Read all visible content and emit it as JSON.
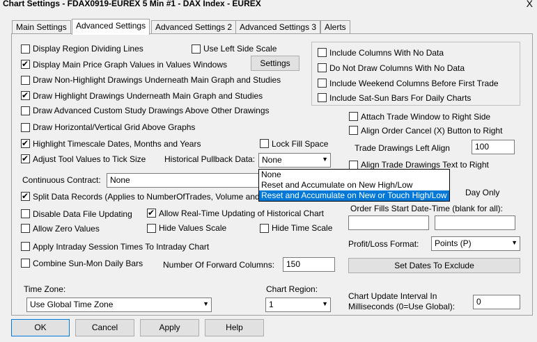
{
  "window": {
    "title": "Chart Settings - FDAX0919-EUREX  5 Min  #1 - DAX Index - EUREX",
    "close": "X"
  },
  "tabs": [
    "Main Settings",
    "Advanced Settings",
    "Advanced Settings 2",
    "Advanced Settings 3",
    "Alerts"
  ],
  "left": {
    "display_region_dividing_lines": "Display Region Dividing Lines",
    "use_left_side_scale": "Use Left Side Scale",
    "display_main_price_graph": "Display Main Price Graph Values in Values Windows",
    "settings_button": "Settings",
    "draw_non_highlight": "Draw Non-Highlight Drawings Underneath Main Graph and Studies",
    "draw_highlight": "Draw Highlight Drawings Underneath Main Graph and Studies",
    "draw_advanced_custom": "Draw Advanced Custom Study Drawings Above Other Drawings",
    "draw_grid_above": "Draw Horizontal/Vertical Grid Above Graphs",
    "highlight_timescale": "Highlight Timescale Dates, Months and Years",
    "lock_fill_space": "Lock Fill Space",
    "adjust_tool_values": "Adjust Tool Values to Tick Size",
    "historical_pullback_label": "Historical Pullback Data:",
    "historical_pullback_value": "None",
    "continuous_contract_label": "Continuous Contract:",
    "continuous_contract_value": "None",
    "split_data_records": "Split Data Records (Applies to NumberOfTrades, Volume and",
    "disable_data_file_updating": "Disable Data File Updating",
    "allow_realtime_updating": "Allow Real-Time Updating of Historical Chart",
    "allow_zero_values": "Allow Zero Values",
    "hide_values_scale": "Hide Values Scale",
    "hide_time_scale": "Hide Time Scale",
    "apply_intraday_session": "Apply Intraday Session Times To Intraday Chart",
    "combine_sun_mon": "Combine Sun-Mon Daily Bars",
    "forward_columns_label": "Number Of Forward Columns:",
    "forward_columns_value": "150",
    "time_zone_label": "Time Zone:",
    "time_zone_value": "Use Global Time Zone",
    "chart_region_label": "Chart Region:",
    "chart_region_value": "1"
  },
  "dropdown_options": [
    "None",
    "Reset and Accumulate on New High/Low",
    "Reset and Accumulate on New or Touch High/Low"
  ],
  "right": {
    "include_columns_no_data": "Include Columns With No Data",
    "do_not_draw_columns": "Do Not Draw Columns With No Data",
    "include_weekend_columns": "Include Weekend Columns Before First Trade",
    "include_sat_sun_bars": "Include Sat-Sun Bars For Daily Charts",
    "attach_trade_window": "Attach Trade Window to Right Side",
    "align_order_cancel": "Align Order Cancel (X) Button to Right",
    "trade_drawings_left_align_label": "Trade Drawings Left Align",
    "trade_drawings_left_align_value": "100",
    "align_trade_drawings_text": "Align Trade Drawings Text to Right",
    "day_only_fragment": "Day Only",
    "order_fills_label": "Order Fills Start Date-Time (blank for all):",
    "profit_loss_label": "Profit/Loss Format:",
    "profit_loss_value": "Points (P)",
    "set_dates_button": "Set Dates To Exclude",
    "chart_update_label_1": "Chart Update Interval In",
    "chart_update_label_2": "Milliseconds (0=Use Global):",
    "chart_update_value": "0"
  },
  "buttons": {
    "ok": "OK",
    "cancel": "Cancel",
    "apply": "Apply",
    "help": "Help"
  }
}
